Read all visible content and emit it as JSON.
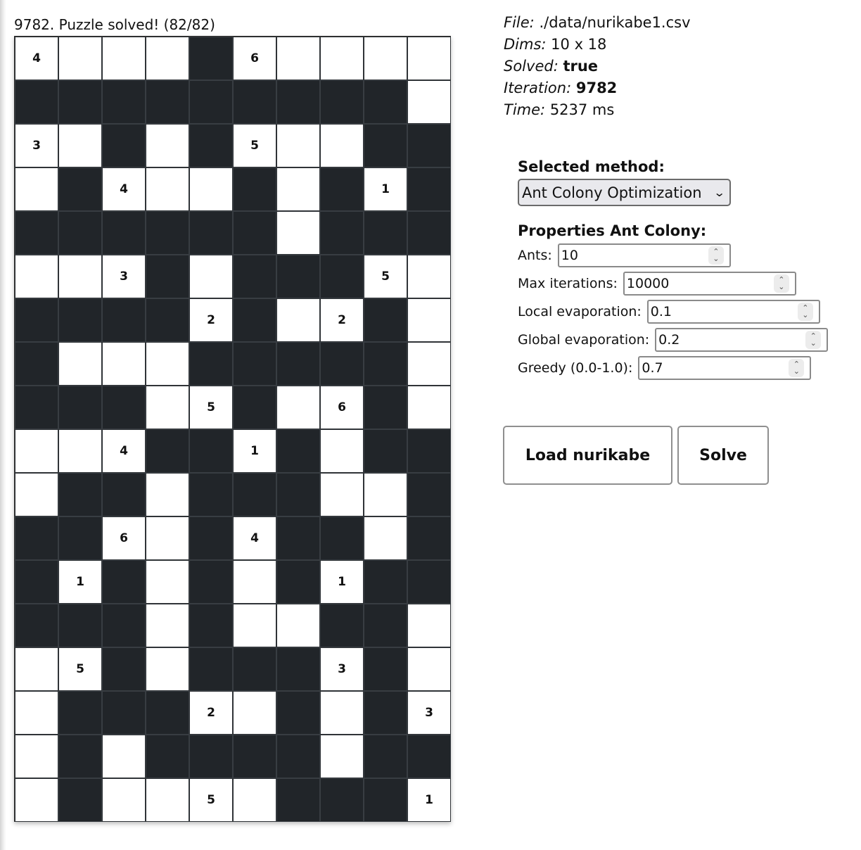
{
  "status": "9782. Puzzle solved! (82/82)",
  "info": {
    "file_label": "File:",
    "file_value": "./data/nurikabe1.csv",
    "dims_label": "Dims:",
    "dims_value": "10 x 18",
    "solved_label": "Solved:",
    "solved_value": "true",
    "iteration_label": "Iteration:",
    "iteration_value": "9782",
    "time_label": "Time:",
    "time_value": "5237 ms"
  },
  "method": {
    "label": "Selected method:",
    "selected": "Ant Colony Optimization"
  },
  "properties": {
    "title": "Properties Ant Colony:",
    "fields": [
      {
        "label": "Ants:",
        "value": "10"
      },
      {
        "label": "Max iterations:",
        "value": "10000"
      },
      {
        "label": "Local evaporation:",
        "value": "0.1"
      },
      {
        "label": "Global evaporation:",
        "value": "0.2"
      },
      {
        "label": "Greedy (0.0-1.0):",
        "value": "0.7"
      }
    ]
  },
  "buttons": {
    "load": "Load nurikabe",
    "solve": "Solve"
  },
  "board": {
    "cols": 10,
    "rows": 18,
    "cells": [
      [
        "4",
        "W",
        "W",
        "W",
        "B",
        "6",
        "W",
        "W",
        "W",
        "W"
      ],
      [
        "B",
        "B",
        "B",
        "B",
        "B",
        "B",
        "B",
        "B",
        "B",
        "W"
      ],
      [
        "3",
        "W",
        "B",
        "W",
        "B",
        "5",
        "W",
        "W",
        "B",
        "B"
      ],
      [
        "W",
        "B",
        "4",
        "W",
        "W",
        "B",
        "W",
        "B",
        "1",
        "B"
      ],
      [
        "B",
        "B",
        "B",
        "B",
        "B",
        "B",
        "W",
        "B",
        "B",
        "B"
      ],
      [
        "W",
        "W",
        "3",
        "B",
        "W",
        "B",
        "B",
        "B",
        "5",
        "W"
      ],
      [
        "B",
        "B",
        "B",
        "B",
        "2",
        "B",
        "W",
        "2",
        "B",
        "W"
      ],
      [
        "B",
        "W",
        "W",
        "W",
        "B",
        "B",
        "B",
        "B",
        "B",
        "W"
      ],
      [
        "B",
        "B",
        "B",
        "W",
        "5",
        "B",
        "W",
        "6",
        "B",
        "W"
      ],
      [
        "W",
        "W",
        "4",
        "B",
        "B",
        "1",
        "B",
        "W",
        "B",
        "B"
      ],
      [
        "W",
        "B",
        "B",
        "W",
        "B",
        "B",
        "B",
        "W",
        "W",
        "B"
      ],
      [
        "B",
        "B",
        "6",
        "W",
        "B",
        "4",
        "B",
        "B",
        "W",
        "B"
      ],
      [
        "B",
        "1",
        "B",
        "W",
        "B",
        "W",
        "B",
        "1",
        "B",
        "B"
      ],
      [
        "B",
        "B",
        "B",
        "W",
        "B",
        "W",
        "W",
        "B",
        "B",
        "W"
      ],
      [
        "W",
        "5",
        "B",
        "W",
        "B",
        "B",
        "B",
        "3",
        "B",
        "W"
      ],
      [
        "W",
        "B",
        "B",
        "B",
        "2",
        "W",
        "B",
        "W",
        "B",
        "3"
      ],
      [
        "W",
        "B",
        "W",
        "B",
        "B",
        "B",
        "B",
        "W",
        "B",
        "B"
      ],
      [
        "W",
        "B",
        "W",
        "W",
        "5",
        "W",
        "B",
        "B",
        "B",
        "1"
      ]
    ]
  }
}
